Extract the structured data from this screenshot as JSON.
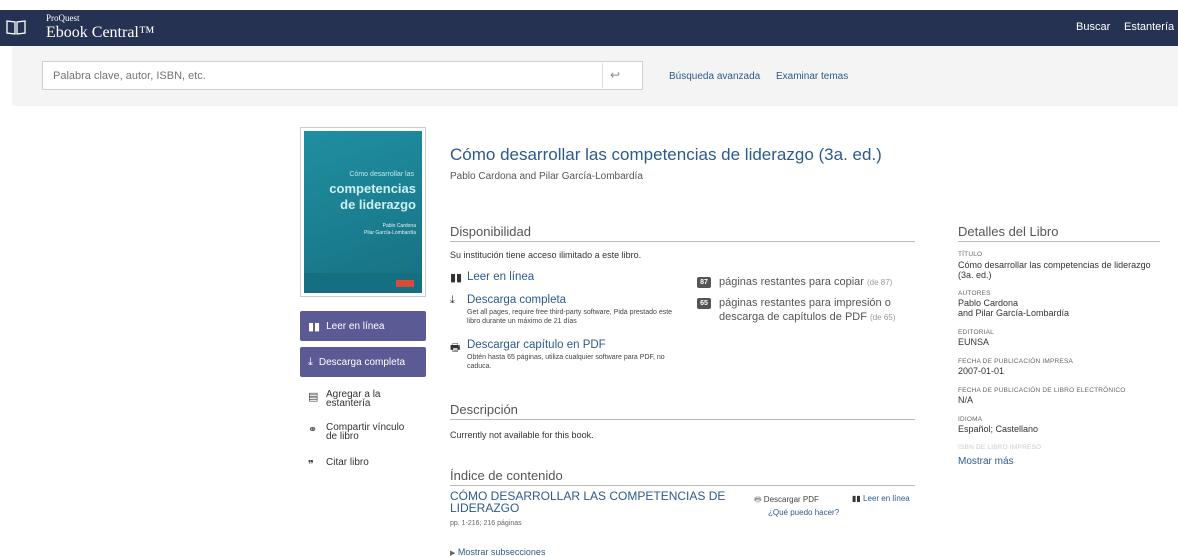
{
  "header": {
    "brand_small": "ProQuest",
    "brand_large": "Ebook Central™",
    "nav_search": "Buscar",
    "nav_bookshelf": "Estantería",
    "bg_color": "#263252"
  },
  "search": {
    "placeholder": "Palabra clave, autor, ISBN, etc.",
    "advanced": "Búsqueda avanzada",
    "browse": "Examinar temas"
  },
  "book": {
    "title": "Cómo desarrollar las competencias de liderazgo (3a. ed.)",
    "authors": "Pablo Cardona and Pilar García-Lombardía",
    "cover": {
      "line1": "Cómo desarrollar las",
      "line2": "competencias",
      "line3": "de liderazgo",
      "authors1": "Pablo Cardona",
      "authors2": "Pilar García-Lombardía"
    }
  },
  "actions": {
    "read_online": "Leer en línea",
    "full_download": "Descarga completa",
    "add_shelf": "Agregar a la estantería",
    "share_link": "Compartir vínculo de libro",
    "cite": "Citar libro",
    "button_color": "#5c5a95"
  },
  "availability": {
    "heading": "Disponibilidad",
    "note": "Su institución tiene acceso ilimitado a este libro.",
    "read_online": "Leer en línea",
    "full_download": "Descarga completa",
    "full_download_sub": "Get all pages, require free third-party software, Pida prestado este libro durante un máximo de 21 días",
    "pdf_chapter": "Descargar capítulo en PDF",
    "pdf_chapter_sub": "Obtén hasta 65 páginas, utiliza cualquier software para PDF, no caduca.",
    "copy_badge": "87",
    "copy_text": "páginas restantes para copiar",
    "copy_of": "(de 87)",
    "print_badge": "65",
    "print_text": "páginas restantes para impresión o descarga de capítulos de PDF",
    "print_of": "(de 65)"
  },
  "description": {
    "heading": "Descripción",
    "text": "Currently not available for this book."
  },
  "toc": {
    "heading": "Índice de contenido",
    "entry_title": "CÓMO DESARROLLAR LAS COMPETENCIAS DE LIDERAZGO",
    "entry_pages": "pp. 1-216; 216 páginas",
    "download_pdf": "Descargar PDF",
    "what_to_do": "¿Qué puedo hacer?",
    "read_online": "Leer en línea",
    "show_subsections": "Mostrar subsecciones"
  },
  "details": {
    "heading": "Detalles del Libro",
    "title_label": "TÍTULO",
    "title_value": "Cómo desarrollar las competencias de liderazgo (3a. ed.)",
    "authors_label": "AUTORES",
    "authors_value1": "Pablo Cardona",
    "authors_value2": "and Pilar García-Lombardía",
    "publisher_label": "EDITORIAL",
    "publisher_value": "EUNSA",
    "print_date_label": "FECHA DE PUBLICACIÓN IMPRESA",
    "print_date_value": "2007-01-01",
    "ebook_date_label": "FECHA DE PUBLICACIÓN DE LIBRO ELECTRÓNICO",
    "ebook_date_value": "N/A",
    "language_label": "IDIOMA",
    "language_value": "Español; Castellano",
    "isbn_label": "ISBN DE LIBRO IMPRESO",
    "show_more": "Mostrar más"
  }
}
